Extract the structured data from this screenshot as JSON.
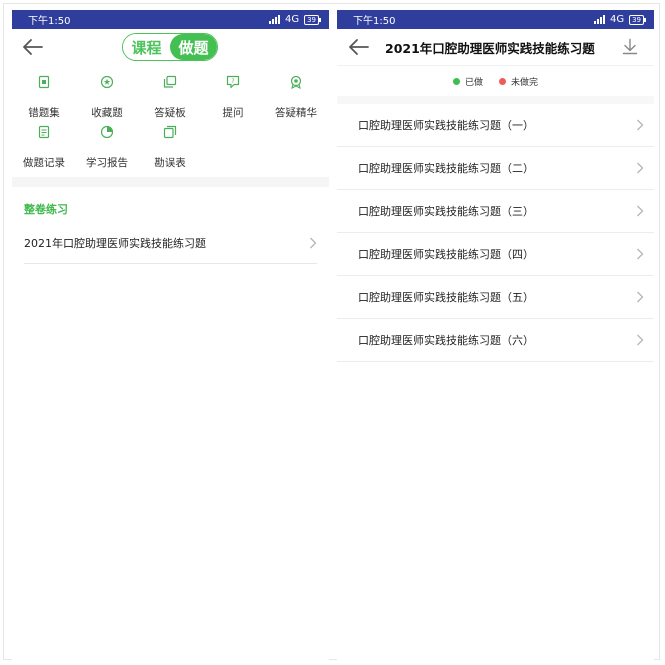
{
  "left": {
    "status": {
      "time": "下午1:50",
      "network": "4G",
      "battery": "39"
    },
    "tabs": [
      {
        "label": "课程",
        "active": false
      },
      {
        "label": "做题",
        "active": true
      }
    ],
    "menu": [
      {
        "label": "错题集",
        "icon": "error-book-icon"
      },
      {
        "label": "收藏题",
        "icon": "favorite-icon"
      },
      {
        "label": "答疑板",
        "icon": "qa-board-icon"
      },
      {
        "label": "提问",
        "icon": "ask-question-icon"
      },
      {
        "label": "答疑精华",
        "icon": "qa-highlights-icon"
      },
      {
        "label": "做题记录",
        "icon": "practice-record-icon"
      },
      {
        "label": "学习报告",
        "icon": "study-report-icon"
      },
      {
        "label": "勘误表",
        "icon": "errata-icon"
      }
    ],
    "section_title": "整卷练习",
    "exam_item": "2021年口腔助理医师实践技能练习题"
  },
  "right": {
    "status": {
      "time": "下午1:50",
      "network": "4G",
      "battery": "39"
    },
    "title": "2021年口腔助理医师实践技能练习题",
    "legend": [
      {
        "label": "已做",
        "color": "#3dbf4f"
      },
      {
        "label": "未做完",
        "color": "#ef5a5a"
      }
    ],
    "items": [
      "口腔助理医师实践技能练习题（一）",
      "口腔助理医师实践技能练习题（二）",
      "口腔助理医师实践技能练习题（三）",
      "口腔助理医师实践技能练习题（四）",
      "口腔助理医师实践技能练习题（五）",
      "口腔助理医师实践技能练习题（六）"
    ]
  },
  "colors": {
    "accent": "#44bf52",
    "statusbar": "#2f3d9c",
    "icon": "#4cae5a"
  }
}
